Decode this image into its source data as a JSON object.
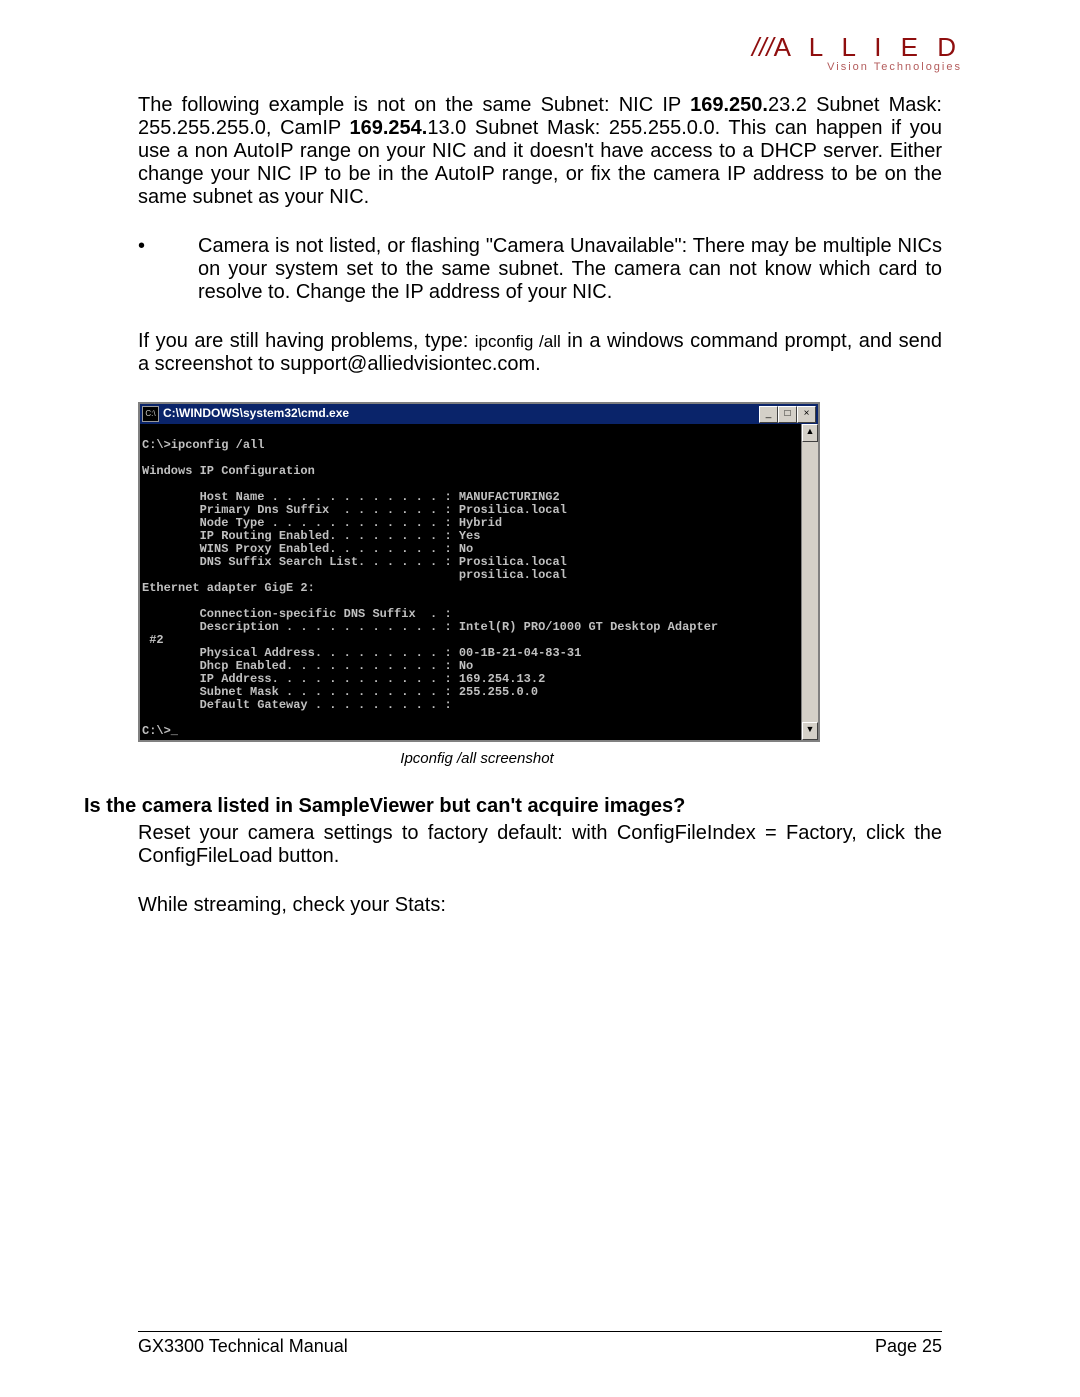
{
  "logo": {
    "slashes": "///",
    "brand": "A L L I E D",
    "sub": "Vision Technologies"
  },
  "para1": {
    "pre1": "The following example is not on the same Subnet: NIC IP ",
    "bold1": "169.250.",
    "mid1": "23.2 Subnet Mask: 255.255.255.0, CamIP ",
    "bold2": "169.254.",
    "post1": "13.0 Subnet Mask: 255.255.0.0. This can happen if you use a non AutoIP range on your NIC and it doesn't have access to a DHCP server. Either change your NIC IP to be in the AutoIP range, or fix the camera IP address to be on the same subnet as your NIC."
  },
  "bullet": {
    "dot": "•",
    "text": "Camera is not listed, or flashing \"Camera Unavailable\": There may be multiple NICs on your system set to the same subnet. The camera can not know which card to resolve to. Change the IP address of your NIC."
  },
  "para2": {
    "pre": "If you are still having problems, type:  ",
    "code": "ipconfig /all",
    "post": " in a windows command prompt, and send a screenshot to support@alliedvisiontec.com."
  },
  "cmd": {
    "title": "C:\\WINDOWS\\system32\\cmd.exe",
    "icon": "C:\\",
    "min": "_",
    "max": "□",
    "close": "×",
    "up": "▲",
    "down": "▼",
    "body": "\nC:\\>ipconfig /all\n\nWindows IP Configuration\n\n        Host Name . . . . . . . . . . . . : MANUFACTURING2\n        Primary Dns Suffix  . . . . . . . : Prosilica.local\n        Node Type . . . . . . . . . . . . : Hybrid\n        IP Routing Enabled. . . . . . . . : Yes\n        WINS Proxy Enabled. . . . . . . . : No\n        DNS Suffix Search List. . . . . . : Prosilica.local\n                                            prosilica.local\nEthernet adapter GigE 2:\n\n        Connection-specific DNS Suffix  . :\n        Description . . . . . . . . . . . : Intel(R) PRO/1000 GT Desktop Adapter\n #2\n        Physical Address. . . . . . . . . : 00-1B-21-04-83-31\n        Dhcp Enabled. . . . . . . . . . . : No\n        IP Address. . . . . . . . . . . . : 169.254.13.2\n        Subnet Mask . . . . . . . . . . . : 255.255.0.0\n        Default Gateway . . . . . . . . . :\n\nC:\\>_"
  },
  "caption": "Ipconfig /all screenshot",
  "heading": "Is the camera listed in SampleViewer but can't acquire images?",
  "para3": "Reset your camera settings to factory default: with ConfigFileIndex = Factory, click the ConfigFileLoad button.",
  "para4": "While streaming, check your Stats:",
  "footer": {
    "left": "GX3300 Technical Manual",
    "right": "Page 25"
  }
}
